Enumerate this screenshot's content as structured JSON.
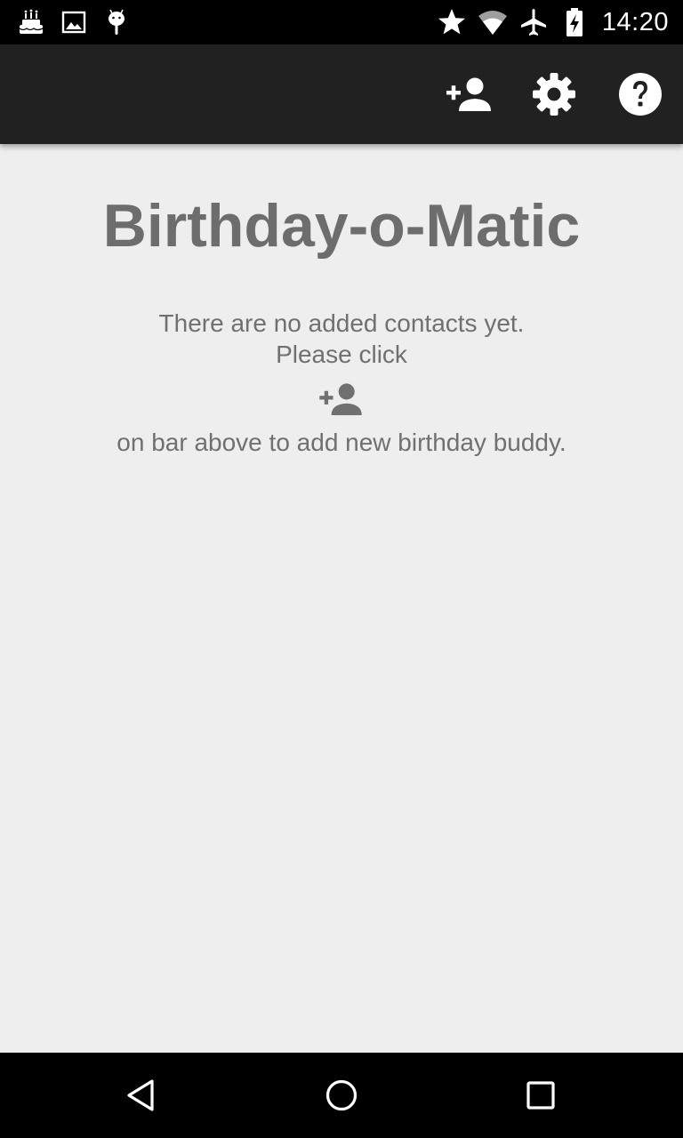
{
  "status_bar": {
    "time": "14:20",
    "left_icons": [
      "birthday-cake-icon",
      "image-icon",
      "android-debug-icon"
    ],
    "right_icons": [
      "star-icon",
      "wifi-icon",
      "airplane-mode-icon",
      "battery-charging-icon"
    ]
  },
  "action_bar": {
    "background": "#212121",
    "actions": [
      "add-contact-icon",
      "settings-gear-icon",
      "help-icon"
    ]
  },
  "main": {
    "title": "Birthday-o-Matic",
    "empty_line1": "There are no added contacts yet.",
    "empty_line2": "Please click",
    "empty_line3": "on bar above to add new birthday buddy.",
    "text_color": "#707070"
  },
  "nav_bar": {
    "buttons": [
      "back-icon",
      "home-icon",
      "recents-icon"
    ]
  }
}
